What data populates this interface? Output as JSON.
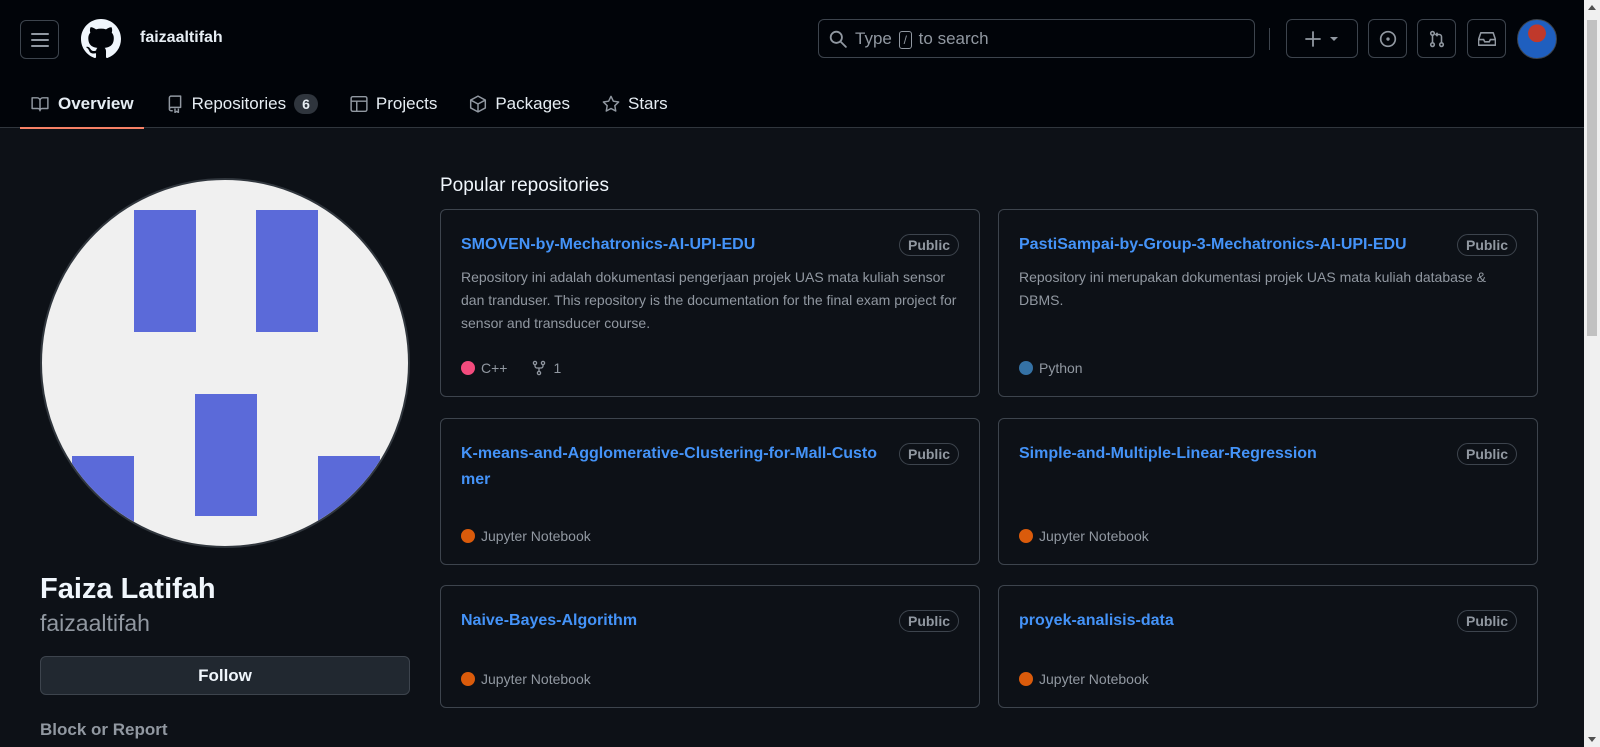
{
  "header": {
    "username": "faizaaltifah",
    "search": {
      "prefix": "Type",
      "key": "/",
      "suffix": "to search"
    }
  },
  "nav": {
    "overview": "Overview",
    "repositories": "Repositories",
    "repositories_count": "6",
    "projects": "Projects",
    "packages": "Packages",
    "stars": "Stars"
  },
  "profile": {
    "full_name": "Faiza Latifah",
    "login": "faizaaltifah",
    "follow_label": "Follow",
    "block_report": "Block or Report"
  },
  "main": {
    "section_title": "Popular repositories",
    "repos": [
      {
        "name": "SMOVEN-by-Mechatronics-AI-UPI-EDU",
        "visibility": "Public",
        "description": "Repository ini adalah dokumentasi pengerjaan projek UAS mata kuliah sensor dan tranduser. This repository is the documentation for the final exam project for sensor and transducer course.",
        "language": "C++",
        "language_color": "#f34b7d",
        "forks": "1"
      },
      {
        "name": "PastiSampai-by-Group-3-Mechatronics-AI-UPI-EDU",
        "visibility": "Public",
        "description": "Repository ini merupakan dokumentasi projek UAS mata kuliah database & DBMS.",
        "language": "Python",
        "language_color": "#3572A5"
      },
      {
        "name": "K-means-and-Agglomerative-Clustering-for-Mall-Customer",
        "visibility": "Public",
        "description": "",
        "language": "Jupyter Notebook",
        "language_color": "#DA5B0B"
      },
      {
        "name": "Simple-and-Multiple-Linear-Regression",
        "visibility": "Public",
        "description": "",
        "language": "Jupyter Notebook",
        "language_color": "#DA5B0B"
      },
      {
        "name": "Naive-Bayes-Algorithm",
        "visibility": "Public",
        "description": "",
        "language": "Jupyter Notebook",
        "language_color": "#DA5B0B"
      },
      {
        "name": "proyek-analisis-data",
        "visibility": "Public",
        "description": "",
        "language": "Jupyter Notebook",
        "language_color": "#DA5B0B"
      }
    ]
  },
  "colors": {
    "accent": "#f78166",
    "link": "#4493f8",
    "background": "#0d1117",
    "header": "#010409"
  }
}
